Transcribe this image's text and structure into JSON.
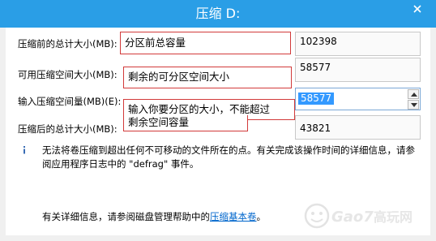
{
  "window": {
    "title": "压缩 D:"
  },
  "fields": [
    {
      "label": "压缩前的总计大小(MB):",
      "annotation": "分区前总容量",
      "value": "102398"
    },
    {
      "label": "可用压缩空间大小(MB):",
      "annotation": "剩余的可分区空间大小",
      "value": "58577"
    },
    {
      "label": "输入压缩空间量(MB)(E):",
      "annotation": "输入你要分区的大小，不能超过",
      "value": "58577"
    },
    {
      "label": "压缩后的总计大小(MB):",
      "annotation": "剩余空间容量",
      "value": "43821"
    }
  ],
  "info": {
    "text": "无法将卷压缩到超出任何不可移动的文件所在的点。有关完成该操作时间的详细信息，请参阅应用程序日志中的 \"defrag\" 事件。"
  },
  "help": {
    "prefix": "有关详细信息，请参阅磁盘管理帮助中的",
    "link": "压缩基本卷",
    "suffix": "。"
  },
  "watermark": {
    "text": "Gao7",
    "suffix": "高玩网"
  },
  "colors": {
    "titlebar": "#2a9ee6",
    "annotation_border": "#d23a3a",
    "selection": "#3399ff",
    "link": "#0066cc"
  }
}
